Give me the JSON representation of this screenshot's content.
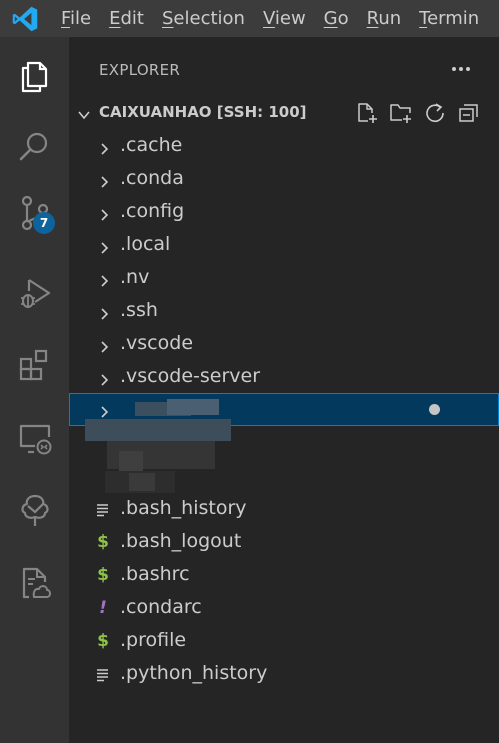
{
  "menu": {
    "items": [
      {
        "mnemonic": "F",
        "rest": "ile"
      },
      {
        "mnemonic": "E",
        "rest": "dit"
      },
      {
        "mnemonic": "S",
        "rest": "election"
      },
      {
        "mnemonic": "V",
        "rest": "iew"
      },
      {
        "mnemonic": "G",
        "rest": "o"
      },
      {
        "mnemonic": "R",
        "rest": "un"
      },
      {
        "mnemonic": "T",
        "rest": "ermin"
      }
    ]
  },
  "activity": {
    "source_control_badge": "7"
  },
  "explorer": {
    "header": "EXPLORER",
    "folder_title": "CAIXUANHAO [SSH: 100]",
    "folders": [
      ".cache",
      ".conda",
      ".config",
      ".local",
      ".nv",
      ".ssh",
      ".vscode",
      ".vscode-server"
    ],
    "files": [
      {
        "name": ".bash_history",
        "icon": "lines-icon"
      },
      {
        "name": ".bash_logout",
        "icon": "dollar-icon"
      },
      {
        "name": ".bashrc",
        "icon": "dollar-icon"
      },
      {
        "name": ".condarc",
        "icon": "exclamation-icon"
      },
      {
        "name": ".profile",
        "icon": "dollar-icon"
      },
      {
        "name": ".python_history",
        "icon": "lines-icon"
      }
    ]
  },
  "colors": {
    "accent": "#007fd4",
    "selection": "#04395e",
    "dollar": "#8dc149",
    "exclamation": "#a074c4",
    "vscode_blue": "#23a9f2"
  }
}
